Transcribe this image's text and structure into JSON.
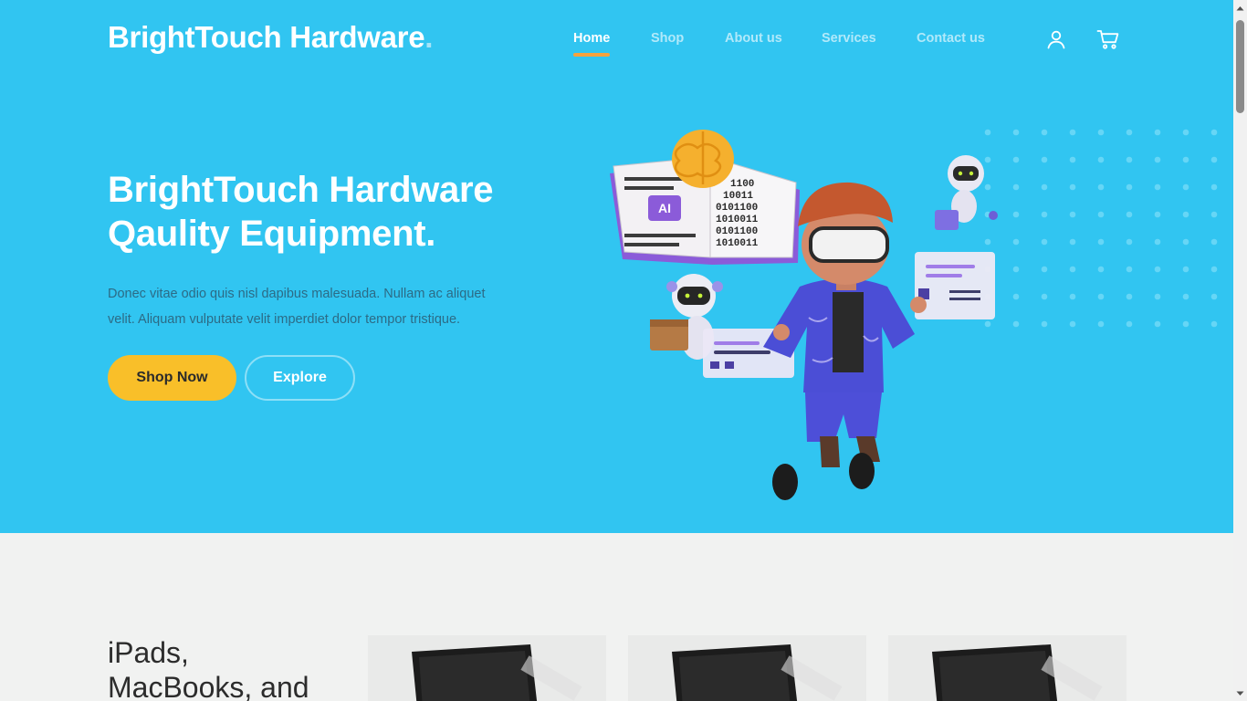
{
  "header": {
    "brand_name": "BrightTouch Hardware",
    "brand_dot": ".",
    "nav": [
      {
        "label": "Home",
        "active": true
      },
      {
        "label": "Shop",
        "active": false
      },
      {
        "label": "About us",
        "active": false
      },
      {
        "label": "Services",
        "active": false
      },
      {
        "label": "Contact us",
        "active": false
      }
    ],
    "icons": [
      "user-icon",
      "cart-icon"
    ]
  },
  "hero": {
    "title_line1": "BrightTouch Hardware",
    "title_line2": "Qaulity Equipment.",
    "description": "Donec vitae odio quis nisl dapibus malesuada. Nullam ac aliquet velit. Aliquam vulputate velit imperdiet dolor tempor tristique.",
    "primary_button": "Shop Now",
    "secondary_button": "Explore",
    "illustration_text": {
      "book_label": "AI",
      "binary_lines": [
        "1100",
        "10011",
        "0101100",
        "1010011",
        "0101100",
        "1010011"
      ]
    }
  },
  "products": {
    "heading_line1": "iPads,",
    "heading_line2": "MacBooks, and",
    "cards": [
      {
        "name": "product-card-1"
      },
      {
        "name": "product-card-2"
      },
      {
        "name": "product-card-3"
      }
    ]
  },
  "colors": {
    "hero_bg": "#31c5f1",
    "accent_yellow": "#f9bf29",
    "nav_underline": "#f7a23c",
    "section_bg": "#f1f2f1"
  }
}
